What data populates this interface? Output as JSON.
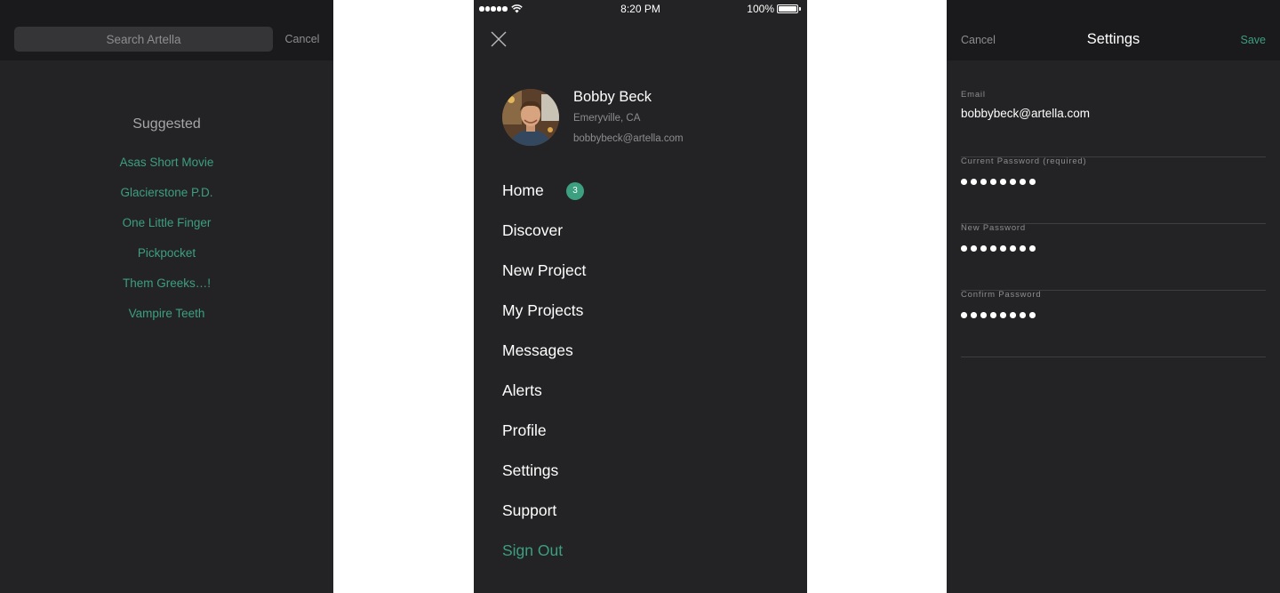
{
  "status_bar": {
    "time": "8:20 PM",
    "battery": "100%",
    "battery_level": 1.0,
    "signal_bars": 5
  },
  "search_screen": {
    "search_placeholder": "Search Artella",
    "cancel_label": "Cancel",
    "suggested_title": "Suggested",
    "suggestions": [
      "Asas Short Movie",
      "Glacierstone P.D.",
      "One Little Finger",
      "Pickpocket",
      "Them Greeks…!",
      "Vampire Teeth"
    ]
  },
  "menu_screen": {
    "profile": {
      "name": "Bobby Beck",
      "location": "Emeryville, CA",
      "email": "bobbybeck@artella.com"
    },
    "items": [
      {
        "label": "Home",
        "badge": "3"
      },
      {
        "label": "Discover"
      },
      {
        "label": "New Project"
      },
      {
        "label": "My Projects"
      },
      {
        "label": "Messages"
      },
      {
        "label": "Alerts"
      },
      {
        "label": "Profile"
      },
      {
        "label": "Settings"
      },
      {
        "label": "Support"
      },
      {
        "label": "Sign Out"
      }
    ]
  },
  "settings_screen": {
    "cancel_label": "Cancel",
    "title": "Settings",
    "save_label": "Save",
    "fields": [
      {
        "label": "Email",
        "value": "bobbybeck@artella.com"
      },
      {
        "label": "Current Password (required)",
        "masked_length": 8
      },
      {
        "label": "New Password",
        "masked_length": 8
      },
      {
        "label": "Confirm Password",
        "masked_length": 8
      }
    ]
  },
  "colors": {
    "background": "#232325",
    "header": "#1a1a1c",
    "accent": "#3c9f80",
    "muted_text": "#8d8d90",
    "divider": "#3e3e41"
  },
  "icons": {
    "close": "close-icon",
    "wifi": "wifi-icon",
    "battery": "battery-icon",
    "signal": "signal-dots-icon"
  }
}
